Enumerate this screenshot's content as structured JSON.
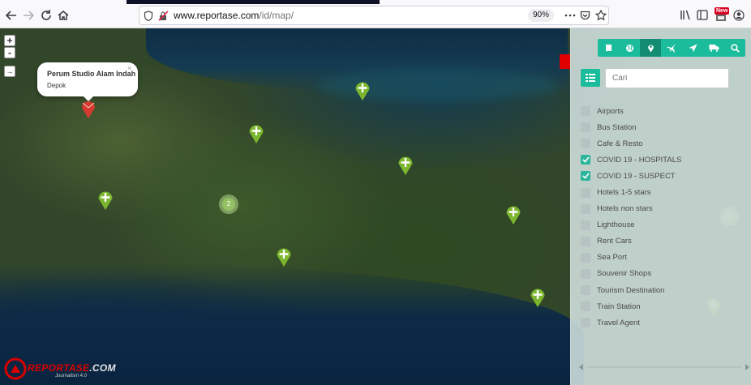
{
  "browser": {
    "url_host": "www.reportase.com",
    "url_path": "/id/map/",
    "zoom": "90%",
    "new_badge": "New"
  },
  "map": {
    "zoom_in": "+",
    "zoom_out": "-",
    "expand": "→",
    "popup": {
      "title": "Perum Studio Alam Indah",
      "subtitle": "Depok",
      "close": "×"
    },
    "cluster_count": "2",
    "logo": {
      "text_a": "REPORTASE",
      "text_b": ".COM",
      "sub": "Journalism 4.0"
    }
  },
  "panel": {
    "search_placeholder": "Cari",
    "tabs": [
      "book-icon",
      "globe-icon",
      "map-marker-icon",
      "plane-icon",
      "location-arrow-icon",
      "truck-icon",
      "search-icon"
    ],
    "categories": [
      {
        "label": "Airports",
        "checked": false
      },
      {
        "label": "Bus Station",
        "checked": false
      },
      {
        "label": "Cafe & Resto",
        "checked": false
      },
      {
        "label": "COVID 19 - HOSPITALS",
        "checked": true
      },
      {
        "label": "COVID 19 - SUSPECT",
        "checked": true
      },
      {
        "label": "Hotels 1-5 stars",
        "checked": false
      },
      {
        "label": "Hotels non stars",
        "checked": false
      },
      {
        "label": "Lighthouse",
        "checked": false
      },
      {
        "label": "Rent Cars",
        "checked": false
      },
      {
        "label": "Sea Port",
        "checked": false
      },
      {
        "label": "Souvenir Shops",
        "checked": false
      },
      {
        "label": "Tourism Destination",
        "checked": false
      },
      {
        "label": "Train Station",
        "checked": false
      },
      {
        "label": "Travel Agent",
        "checked": false
      }
    ]
  },
  "colors": {
    "accent": "#1bbc9b",
    "marker_green": "#7cb62f",
    "marker_red": "#d63a2f"
  }
}
